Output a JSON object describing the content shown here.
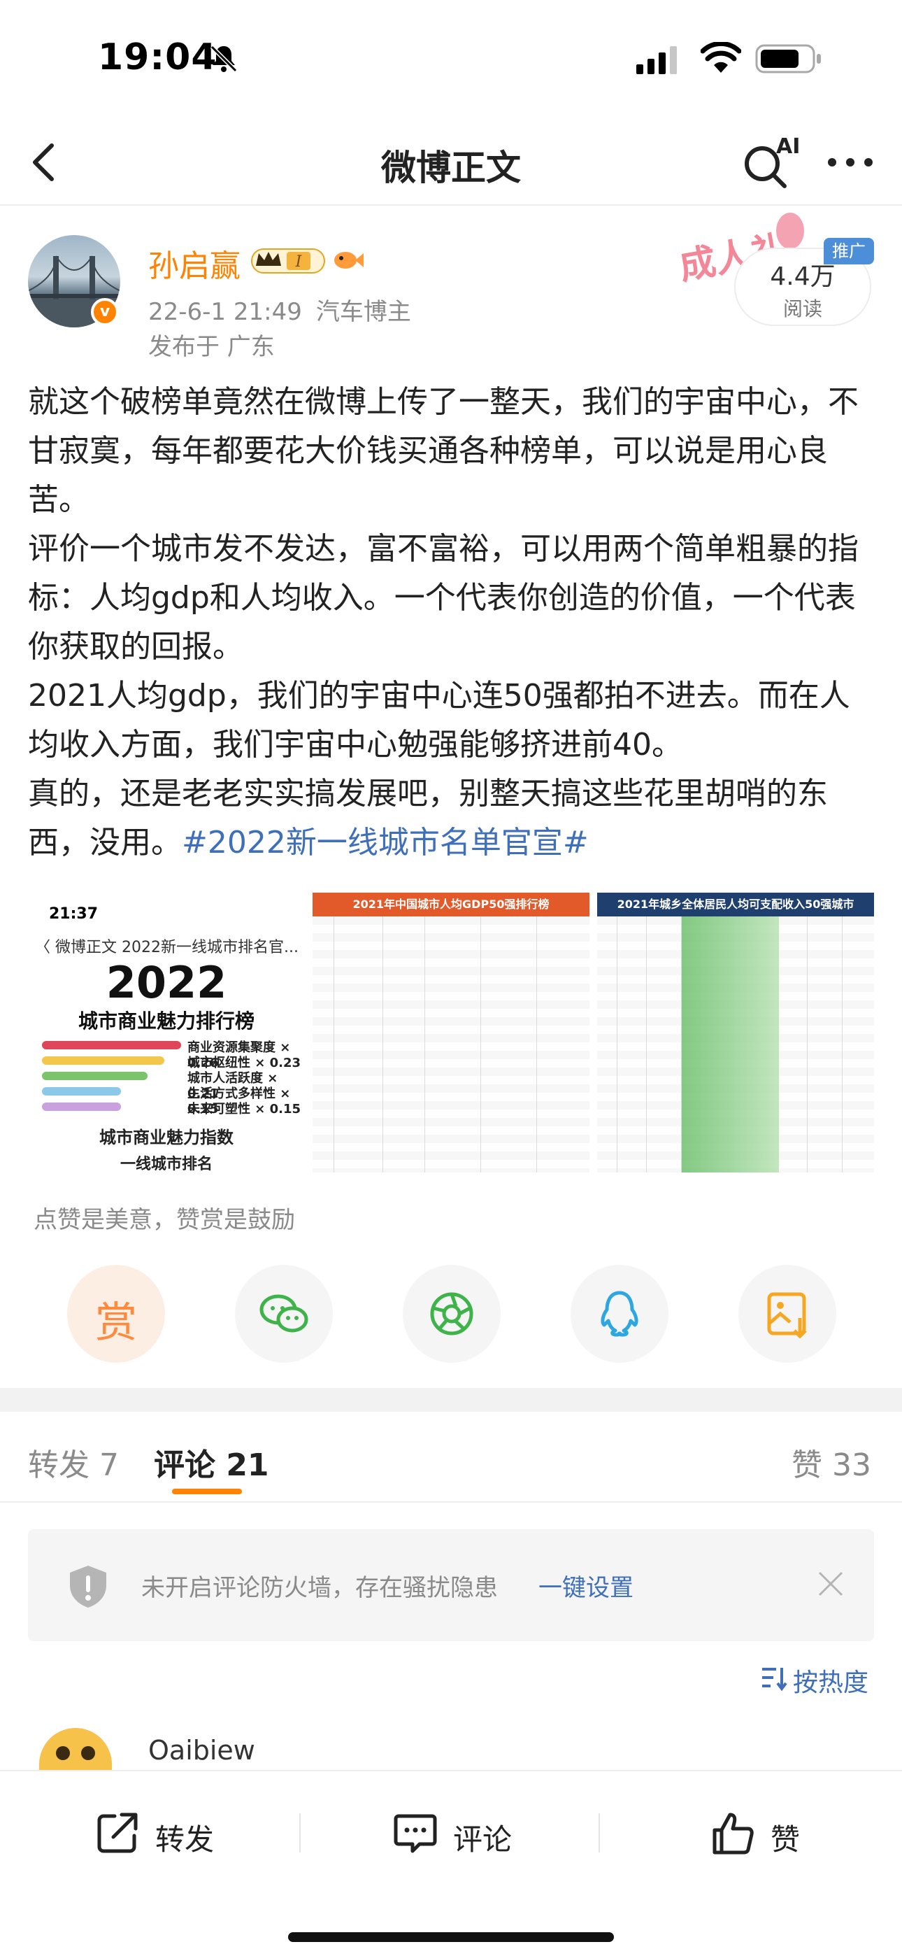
{
  "status_bar": {
    "time": "19:04"
  },
  "nav": {
    "title": "微博正文",
    "ai_label": "AI"
  },
  "author": {
    "name": "孙启赢",
    "vip_level": "I",
    "avatar_badge": "v",
    "date": "22-6-1 21:49",
    "source": "汽车博主",
    "location": "发布于 广东",
    "read_count": "4.4万",
    "read_label": "阅读",
    "promo_tag": "推广",
    "deco_text": "成人礼"
  },
  "post": {
    "p1": "就这个破榜单竟然在微博上传了一整天，我们的宇宙中心，不甘寂寞，每年都要花大价钱买通各种榜单，可以说是用心良苦。",
    "p2": "评价一个城市发不发达，富不富裕，可以用两个简单粗暴的指标：人均gdp和人均收入。一个代表你创造的价值，一个代表你获取的回报。",
    "p3": "2021人均gdp，我们的宇宙中心连50强都拍不进去。而在人均收入方面，我们宇宙中心勉强能够挤进前40。",
    "p4_text": "真的，还是老老实实搞发展吧，别整天搞这些花里胡哨的东西，没用。",
    "hashtag": "#2022新一线城市名单官宣#"
  },
  "images": {
    "img1": {
      "time": "21:37",
      "nav": "〈 微博正文  2022新一线城市排名官...",
      "title_big": "2022",
      "title_sub": "城市商业魅力排行榜",
      "bars": [
        {
          "label": "商业资源集聚度 × 0.26",
          "color": "#e0465a",
          "fraction": 0.83
        },
        {
          "label": "城市枢纽性 × 0.23",
          "color": "#f3c84a",
          "fraction": 0.73
        },
        {
          "label": "城市人活跃度 × 0.21",
          "color": "#7cc46b",
          "fraction": 0.63
        },
        {
          "label": "生活方式多样性 × 0.15",
          "color": "#8cc9e8",
          "fraction": 0.47
        },
        {
          "label": "未来可塑性 × 0.15",
          "color": "#c9a1de",
          "fraction": 0.47
        }
      ],
      "foot1": "城市商业魅力指数",
      "foot2": "一线城市排名"
    },
    "img2": {
      "header": "2021年中国城市人均GDP50强排行榜"
    },
    "img3": {
      "header": "2021年城乡全体居民人均可支配收入50强城市"
    }
  },
  "praise_hint": "点赞是美意，赞赏是鼓励",
  "share": {
    "reward_label": "赏"
  },
  "tabs": {
    "repost": "转发 7",
    "comment": "评论 21",
    "like": "赞 33"
  },
  "notice": {
    "text": "未开启评论防火墙，存在骚扰隐患",
    "link": "一键设置"
  },
  "sort": {
    "label": "按热度"
  },
  "comment": {
    "name": "Oaibiew"
  },
  "toolbar": {
    "repost": "转发",
    "comment": "评论",
    "like": "赞"
  }
}
